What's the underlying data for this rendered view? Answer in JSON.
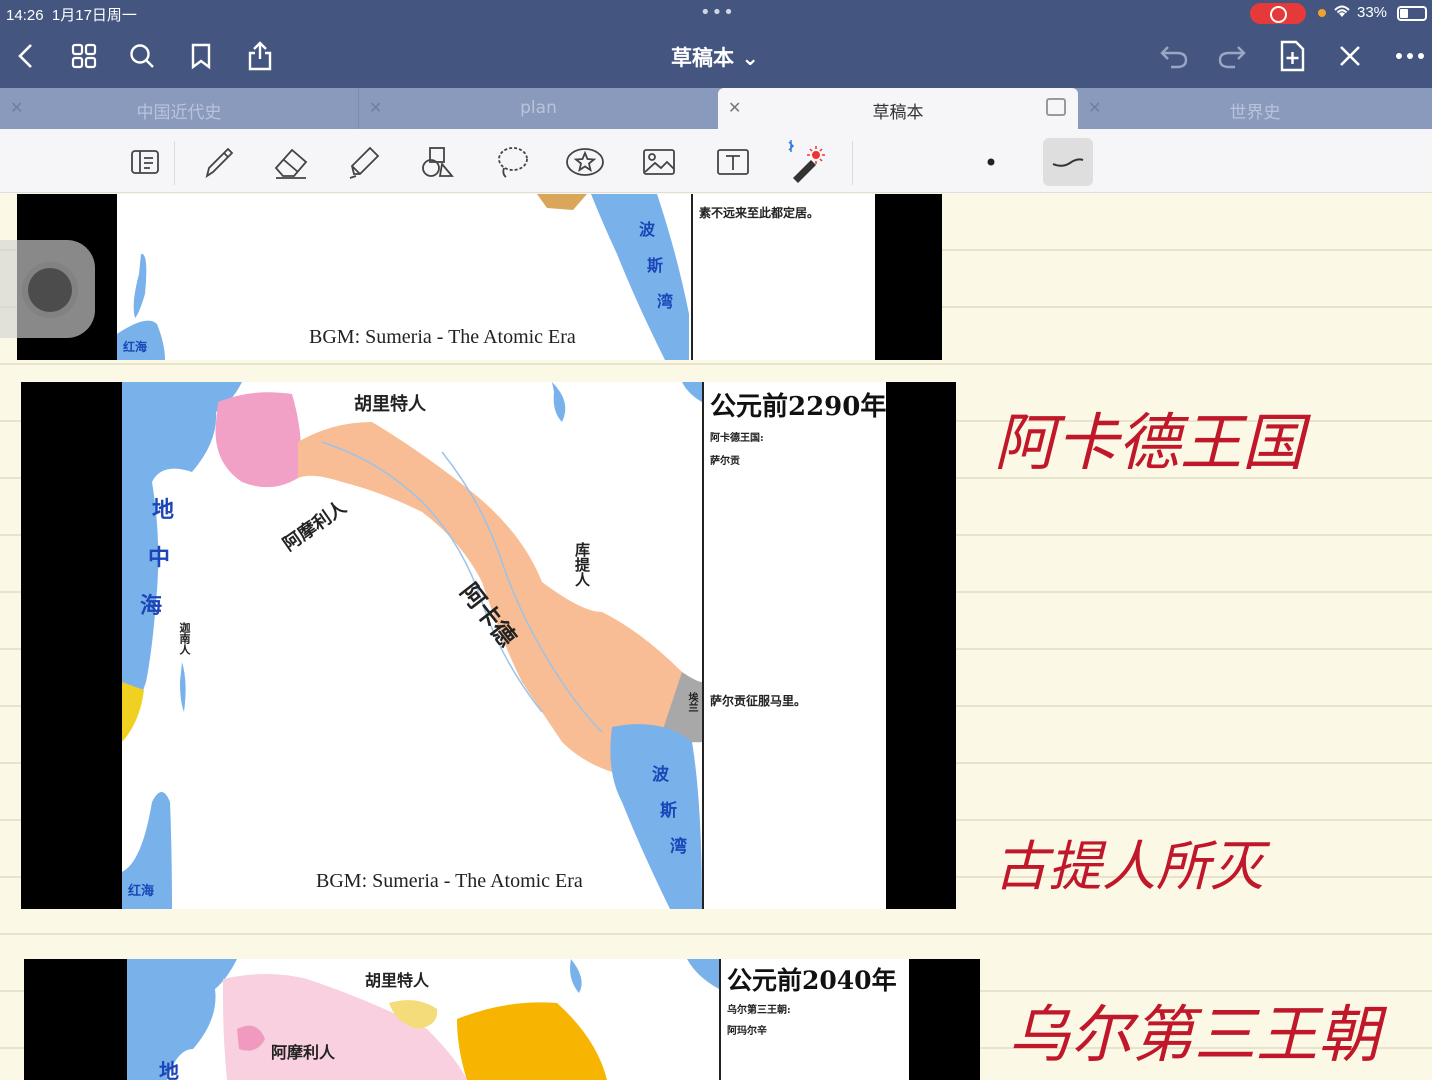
{
  "status": {
    "time": "14:26",
    "date": "1月17日周一",
    "battery": "33%"
  },
  "nav": {
    "title": "草稿本 ⌄"
  },
  "tabs": [
    {
      "label": "中国近代史",
      "active": false
    },
    {
      "label": "plan",
      "active": false
    },
    {
      "label": "草稿本",
      "active": true
    },
    {
      "label": "世界史",
      "active": false
    }
  ],
  "slides": {
    "top": {
      "caption": "BGM: Sumeria - The Atomic Era",
      "note": "素不远来至此都定居。",
      "sea_red": "红海",
      "gulf": [
        "波",
        "斯",
        "湾"
      ]
    },
    "middle": {
      "caption": "BGM: Sumeria - The Atomic Era",
      "year": "公元前2290年",
      "sub1": "阿卡德王国:",
      "sub2": "萨尔贡",
      "note": "萨尔贡征服马里。",
      "labels": {
        "north": "胡里特人",
        "west": "阿摩利人",
        "center": "阿卡德",
        "east": "库提人",
        "sea": [
          "地",
          "中",
          "海"
        ],
        "canaan": "迦南人",
        "gulf": [
          "波",
          "斯",
          "湾"
        ],
        "red": "红海",
        "elam": "埃兰"
      }
    },
    "bottom": {
      "year": "公元前2040年",
      "sub1": "乌尔第三王朝:",
      "sub2": "阿玛尔辛",
      "labels": {
        "north": "胡里特人",
        "west": "阿摩利人",
        "sea": "地"
      }
    }
  },
  "handwriting": [
    "阿卡德王国",
    "古提人所灭",
    "乌尔第三王朝"
  ]
}
